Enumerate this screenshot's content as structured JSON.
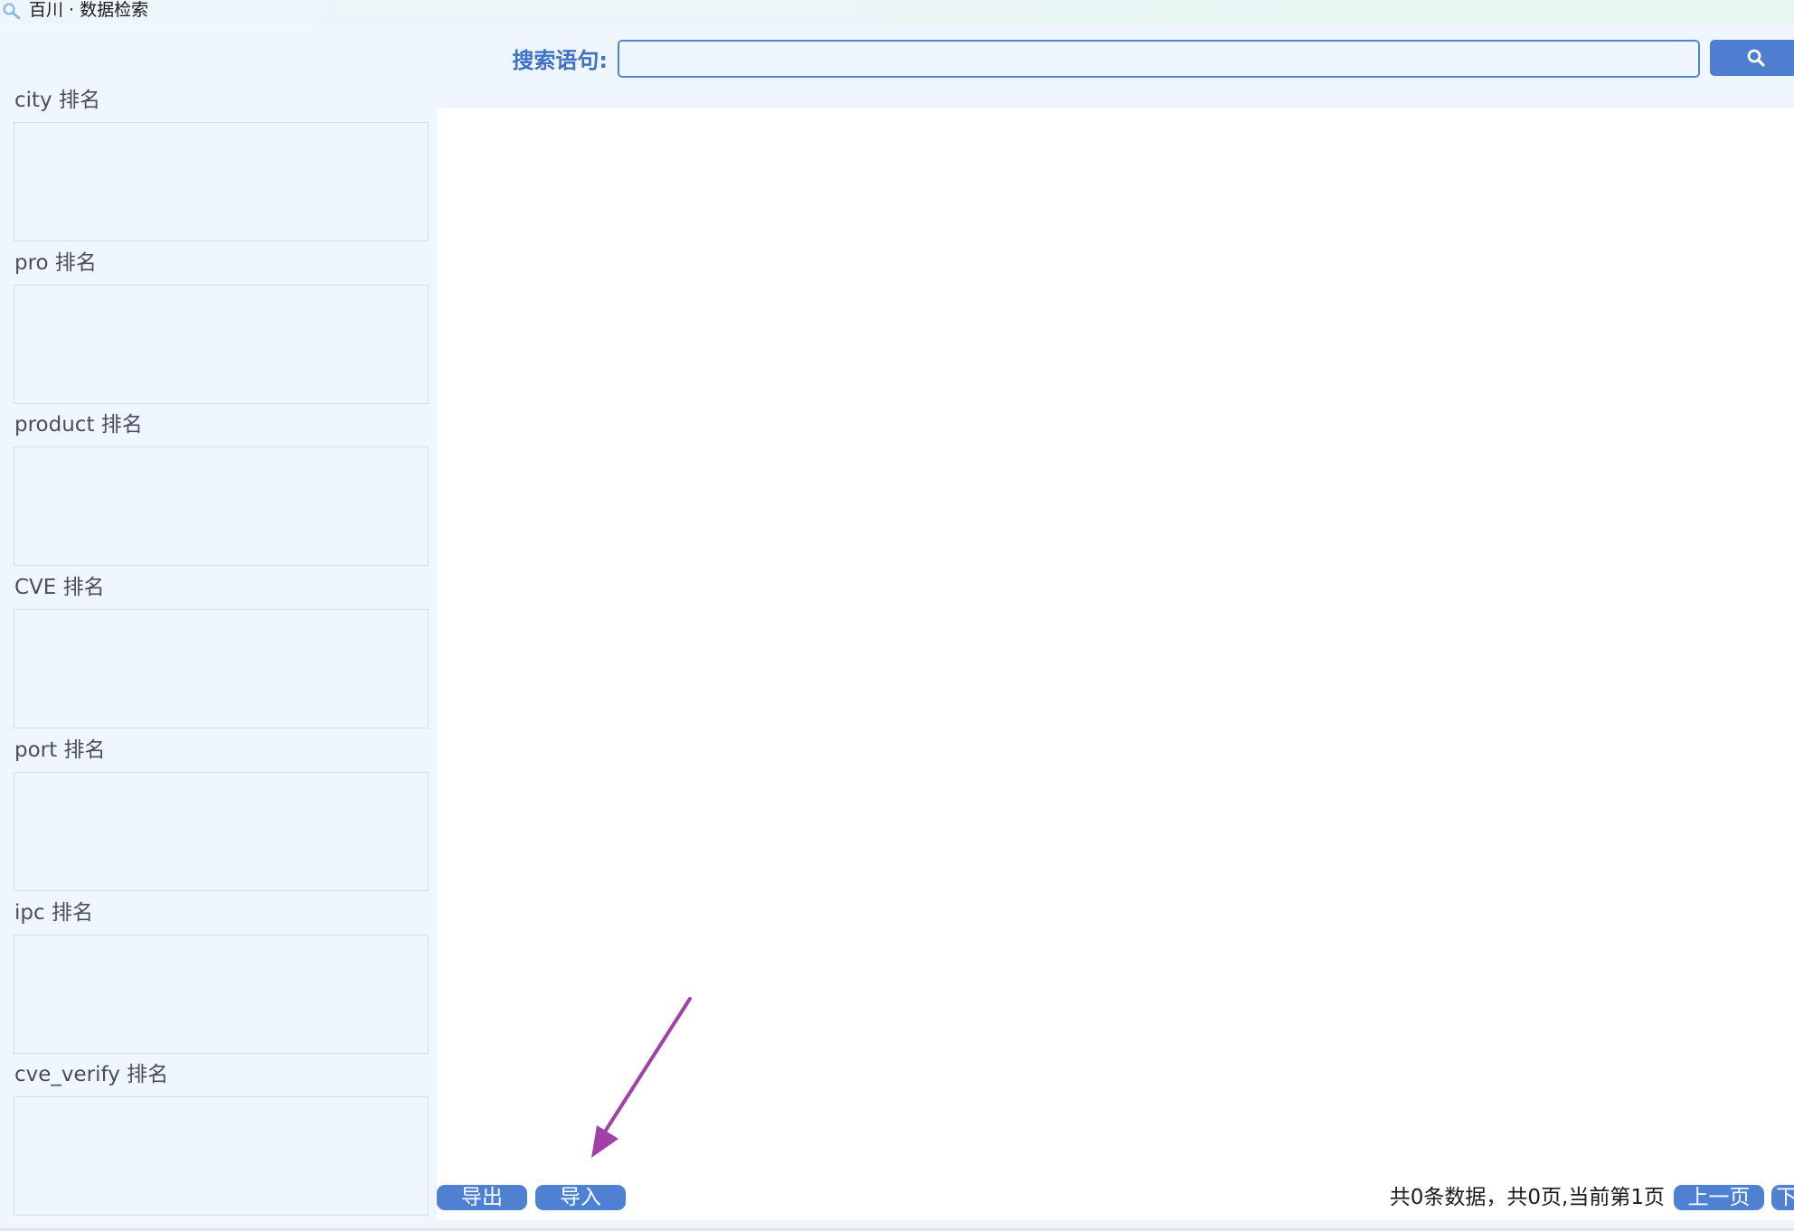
{
  "window": {
    "title": "百川 · 数据检索"
  },
  "search": {
    "label": "搜索语句:",
    "value": "",
    "placeholder": ""
  },
  "sidebar": {
    "rankings": [
      {
        "label": "city 排名"
      },
      {
        "label": "pro 排名"
      },
      {
        "label": "product 排名"
      },
      {
        "label": "CVE 排名"
      },
      {
        "label": "port 排名"
      },
      {
        "label": "ipc 排名"
      },
      {
        "label": "cve_verify 排名"
      }
    ]
  },
  "footer": {
    "export_label": "导出",
    "import_label": "导入",
    "status": "共0条数据，共0页,当前第1页",
    "prev_label": "上一页",
    "next_label": "下一页"
  },
  "colors": {
    "accent": "#4e81d2",
    "label_blue": "#3f72c4",
    "background": "#f0f6fd",
    "annotation_arrow": "#a040a8"
  },
  "icons": {
    "app": "magnifier-icon",
    "search": "search-icon"
  }
}
